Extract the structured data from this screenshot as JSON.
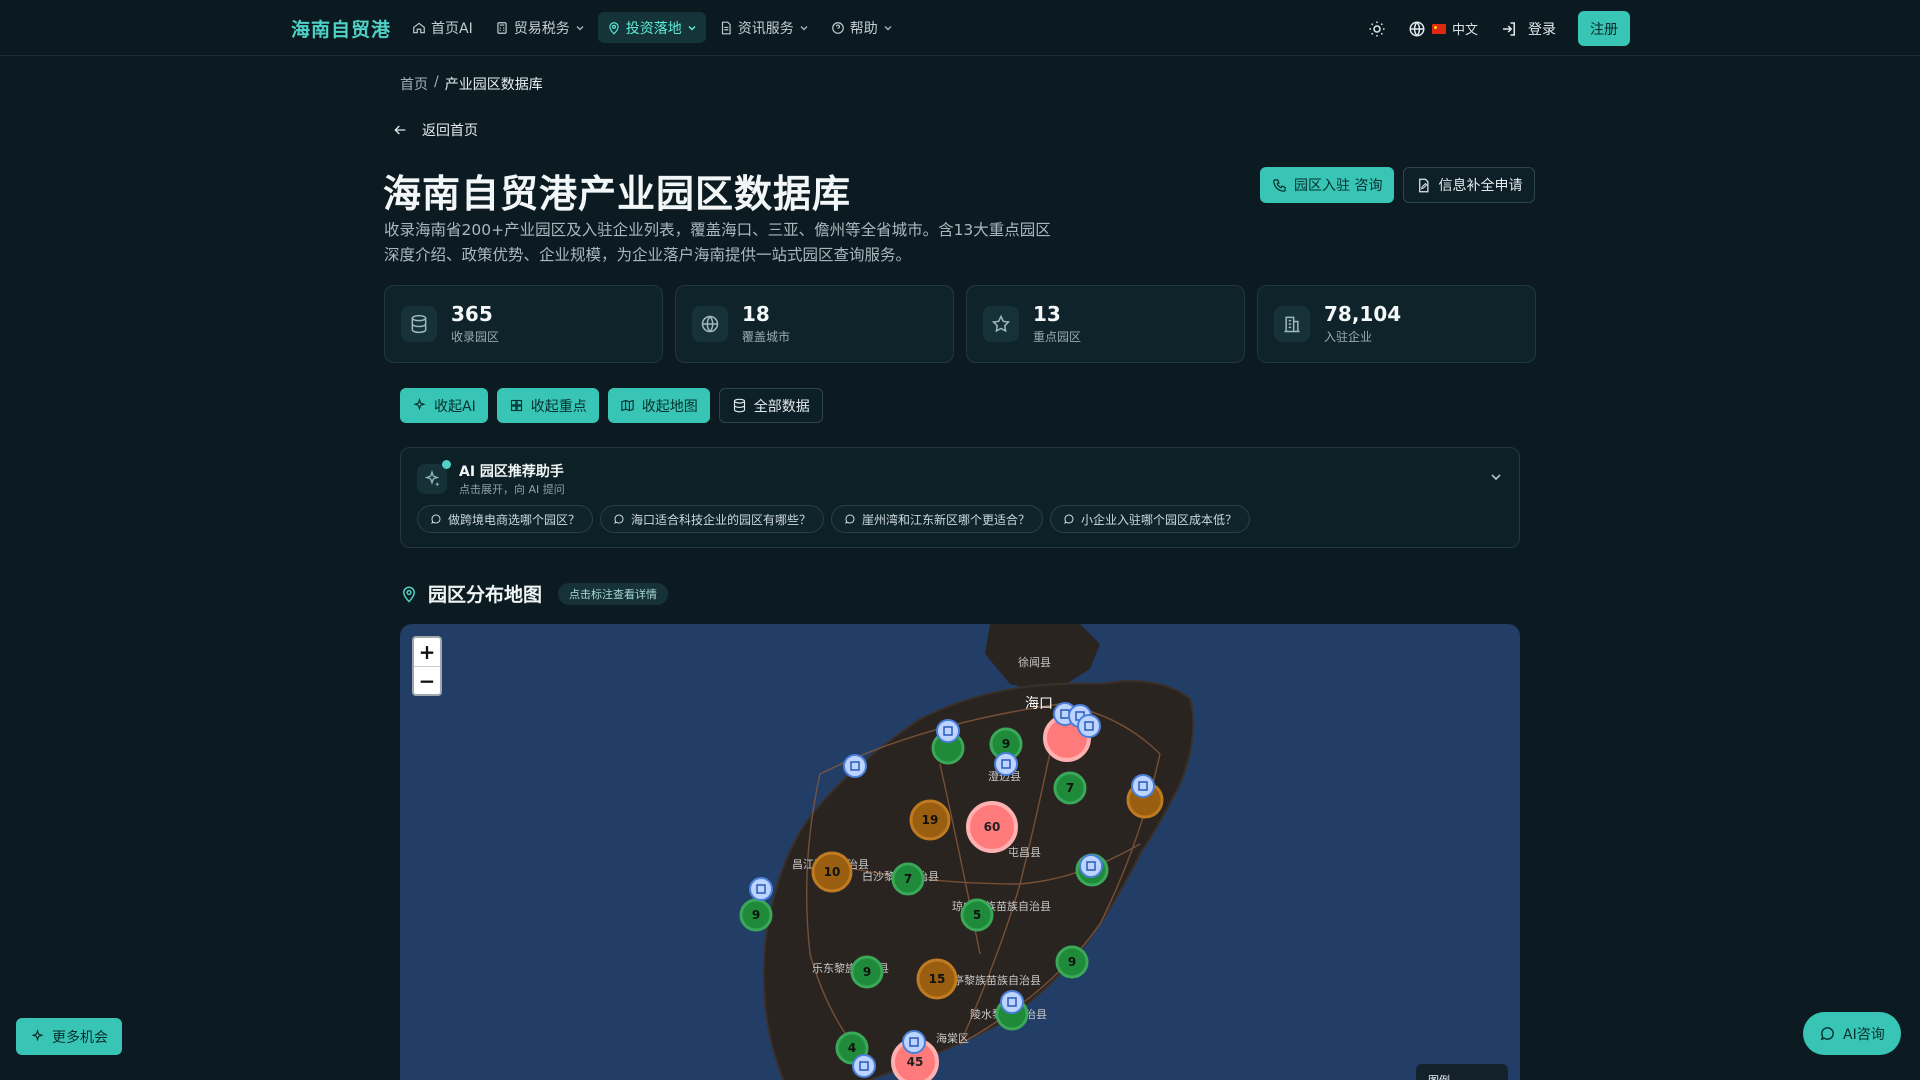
{
  "header": {
    "brand": "海南自贸港",
    "nav": [
      {
        "label": "首页AI"
      },
      {
        "label": "贸易税务"
      },
      {
        "label": "投资落地"
      },
      {
        "label": "资讯服务"
      },
      {
        "label": "帮助"
      }
    ],
    "lang": "中文",
    "login": "登录",
    "register": "注册"
  },
  "breadcrumb": {
    "home": "首页",
    "sep": "/",
    "current": "产业园区数据库"
  },
  "back_label": "返回首页",
  "page": {
    "title": "海南自贸港产业园区数据库",
    "description": "收录海南省200+产业园区及入驻企业列表，覆盖海口、三亚、儋州等全省城市。含13大重点园区深度介绍、政策优势、企业规模，为企业落户海南提供一站式园区查询服务。",
    "btn_consult": "园区入驻 咨询",
    "btn_supplement": "信息补全申请"
  },
  "stats": [
    {
      "value": "365",
      "label": "收录园区",
      "icon": "database-icon"
    },
    {
      "value": "18",
      "label": "覆盖城市",
      "icon": "globe-icon"
    },
    {
      "value": "13",
      "label": "重点园区",
      "icon": "star-icon"
    },
    {
      "value": "78,104",
      "label": "入驻企业",
      "icon": "building-icon"
    }
  ],
  "toggles": {
    "ai": "收起AI",
    "key": "收起重点",
    "map": "收起地图",
    "all": "全部数据"
  },
  "ai": {
    "title": "AI 园区推荐助手",
    "subtitle": "点击展开，向 AI 提问",
    "chips": [
      "做跨境电商选哪个园区？",
      "海口适合科技企业的园区有哪些？",
      "崖州湾和江东新区哪个更适合？",
      "小企业入驻哪个园区成本低？"
    ]
  },
  "map": {
    "title": "园区分布地图",
    "tag": "点击标注查看详情",
    "zoom_in": "+",
    "zoom_out": "−",
    "legend": "图例",
    "labels": [
      "徐闻县",
      "海口",
      "澄迈县",
      "屯昌县",
      "昌江黎族自治县",
      "白沙黎族自治县",
      "琼中黎族苗族自治县",
      "乐东黎族自治县",
      "保亭黎族苗族自治县",
      "陵水黎族自治县",
      "海棠区"
    ],
    "clusters": [
      "60",
      "19",
      "10",
      "7",
      "5",
      "15",
      "9",
      "9",
      "9",
      "9",
      "7",
      "4",
      "45"
    ]
  },
  "floating": {
    "more": "更多机会",
    "ai_consult": "AI咨询"
  }
}
